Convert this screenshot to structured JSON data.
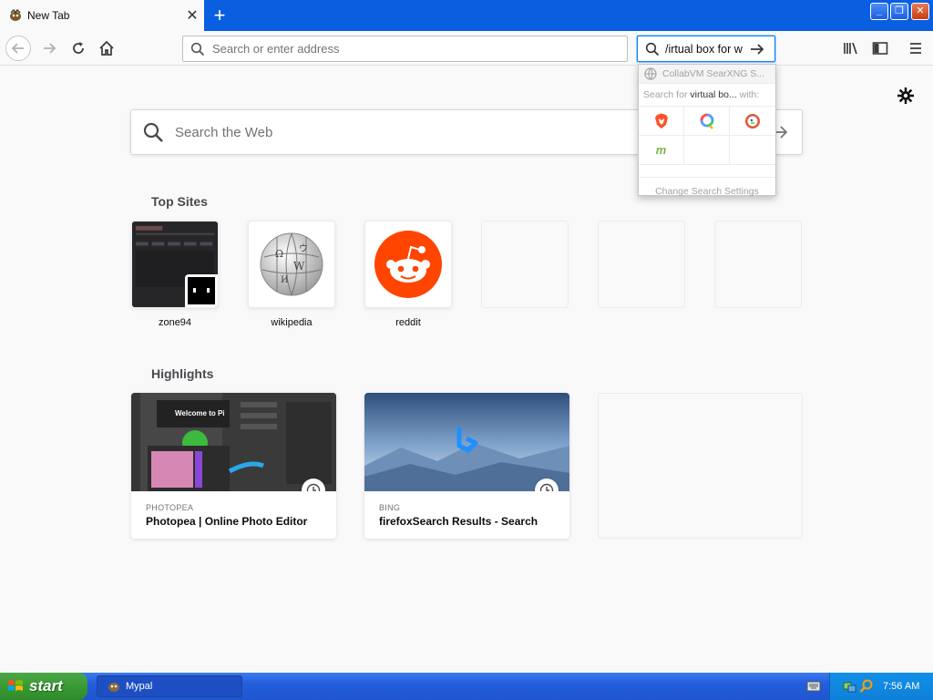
{
  "tabstrip": {
    "tab_title": "New Tab",
    "new_tab_symbol": "+"
  },
  "navbar": {
    "url_placeholder": "Search or enter address",
    "search_value": "/irtual box for w"
  },
  "newtab": {
    "web_search_placeholder": "Search the Web",
    "top_sites_title": "Top Sites",
    "top_sites": [
      {
        "label": "zone94"
      },
      {
        "label": "wikipedia"
      },
      {
        "label": "reddit"
      }
    ],
    "highlights_title": "Highlights",
    "highlights": [
      {
        "source": "PHOTOPEA",
        "title": "Photopea | Online Photo Editor",
        "thumb_text": "Welcome to Pi"
      },
      {
        "source": "BING",
        "title": "firefoxSearch Results - Search"
      }
    ]
  },
  "search_popup": {
    "engine_name": "CollabVM SearXNG S...",
    "search_for_prefix": "Search for",
    "search_for_term": "virtual bo...",
    "search_for_suffix": "with:",
    "engines": [
      "brave-icon",
      "qwant-icon",
      "duckduckgo-icon",
      "mojeek-icon"
    ],
    "change_settings": "Change Search Settings"
  },
  "taskbar": {
    "start_label": "start",
    "task_label": "Mypal",
    "clock": "7:56 AM"
  },
  "colors": {
    "accent": "#0a84ff",
    "titlebar": "#0a5ee0",
    "reddit": "#ff4500",
    "taskbar": "#245edb"
  }
}
